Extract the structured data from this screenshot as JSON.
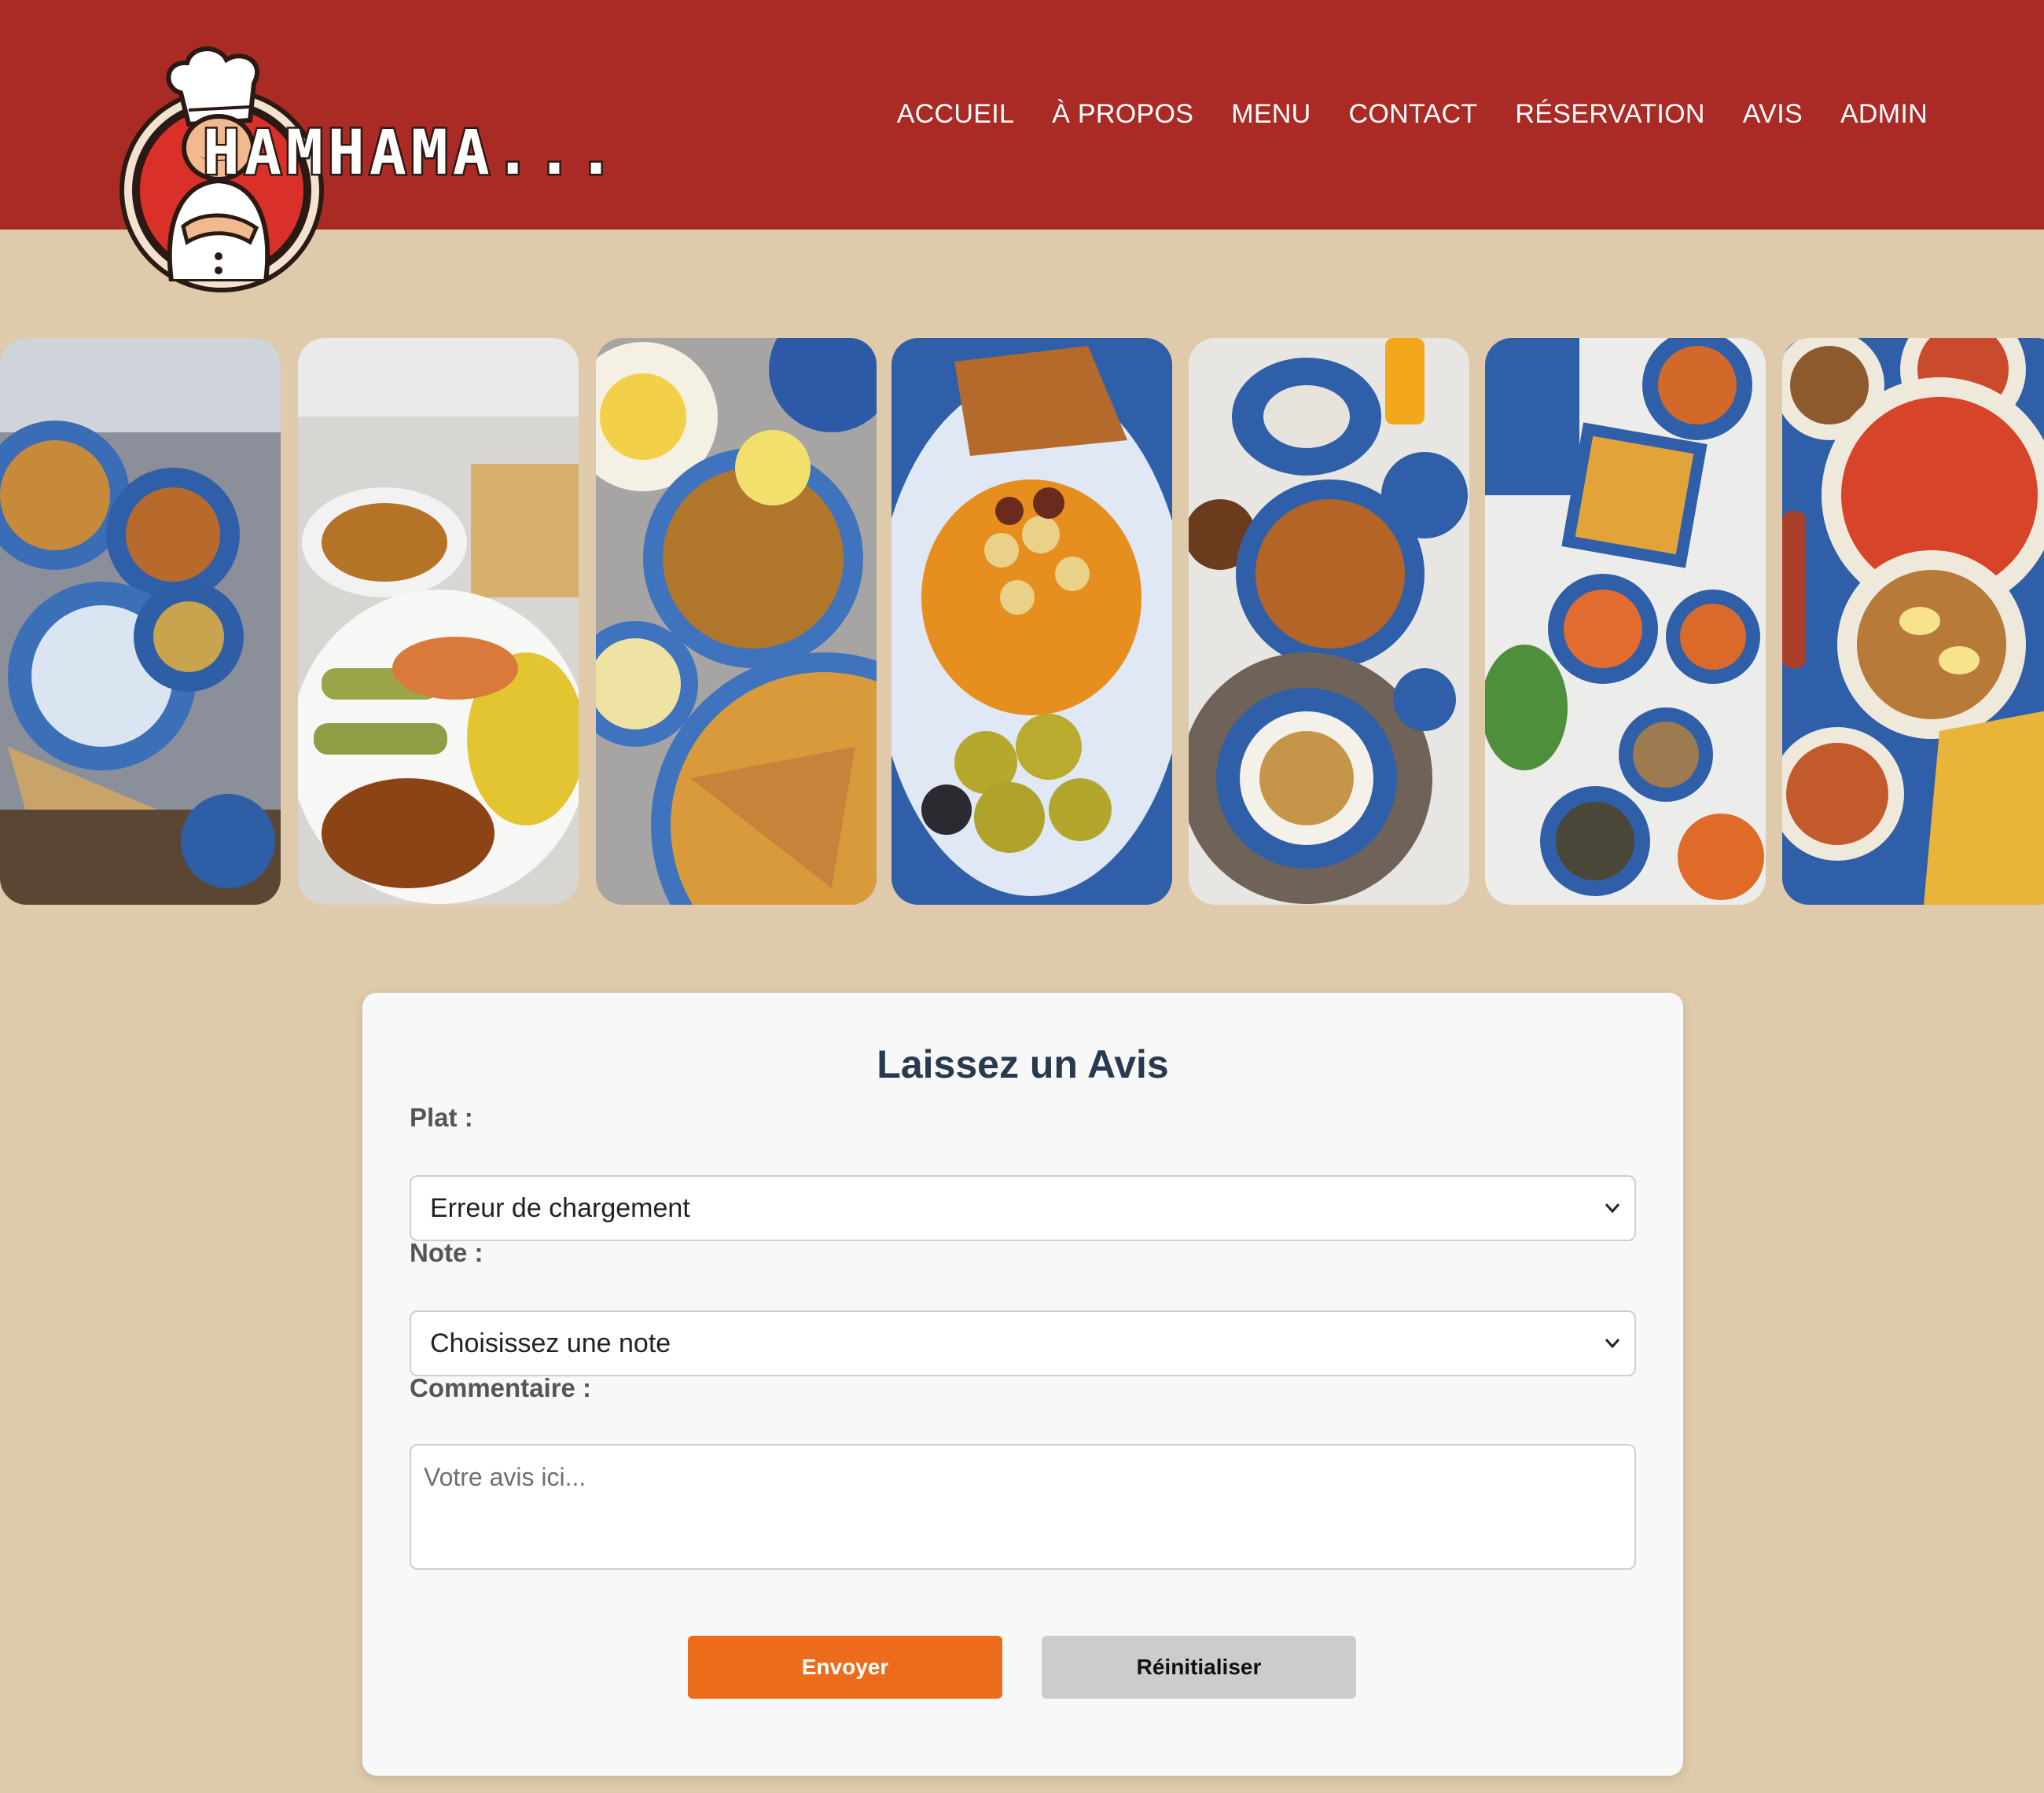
{
  "header": {
    "logo_text": "HAMHAMA...",
    "nav": [
      {
        "label": "ACCUEIL"
      },
      {
        "label": "À PROPOS"
      },
      {
        "label": "MENU"
      },
      {
        "label": "CONTACT"
      },
      {
        "label": "RÉSERVATION"
      },
      {
        "label": "AVIS"
      },
      {
        "label": "ADMIN"
      }
    ]
  },
  "gallery": {
    "images": [
      {
        "name": "dish-photo-1"
      },
      {
        "name": "dish-photo-2"
      },
      {
        "name": "dish-photo-3"
      },
      {
        "name": "dish-photo-4"
      },
      {
        "name": "dish-photo-5"
      },
      {
        "name": "dish-photo-6"
      },
      {
        "name": "dish-photo-7"
      }
    ]
  },
  "review_form": {
    "title": "Laissez un Avis",
    "dish_label": "Plat :",
    "dish_value": "Erreur de chargement",
    "rating_label": "Note :",
    "rating_value": "Choisissez une note",
    "comment_label": "Commentaire :",
    "comment_placeholder": "Votre avis ici...",
    "submit_label": "Envoyer",
    "reset_label": "Réinitialiser"
  },
  "colors": {
    "header_bg": "#aa2a26",
    "page_bg": "#dfcbab",
    "submit_bg": "#ec6c1c",
    "reset_bg": "#cccccc",
    "title_color": "#283a4f"
  }
}
